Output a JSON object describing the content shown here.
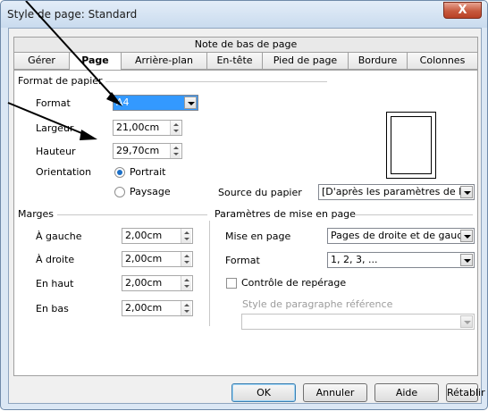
{
  "window": {
    "title": "Style de page: Standard",
    "close_label": "X"
  },
  "tabs": {
    "top_row": "Note de bas de page",
    "items": [
      {
        "label": "Gérer"
      },
      {
        "label": "Page"
      },
      {
        "label": "Arrière-plan"
      },
      {
        "label": "En-tête"
      },
      {
        "label": "Pied de page"
      },
      {
        "label": "Bordure"
      },
      {
        "label": "Colonnes"
      }
    ],
    "active": "Page"
  },
  "paper_format": {
    "section_title": "Format de papier",
    "format_label": "Format",
    "format_value": "A4",
    "width_label": "Largeur",
    "width_value": "21,00cm",
    "height_label": "Hauteur",
    "height_value": "29,70cm",
    "orientation_label": "Orientation",
    "portrait_label": "Portrait",
    "landscape_label": "Paysage",
    "paper_source_label": "Source du papier",
    "paper_source_value": "[D'après les paramètres de l'"
  },
  "margins": {
    "section_title": "Marges",
    "left_label": "À gauche",
    "left_value": "2,00cm",
    "right_label": "À droite",
    "right_value": "2,00cm",
    "top_label": "En haut",
    "top_value": "2,00cm",
    "bottom_label": "En bas",
    "bottom_value": "2,00cm"
  },
  "layout": {
    "section_title": "Paramètres de mise en page",
    "page_layout_label": "Mise en page",
    "page_layout_value": "Pages de droite et de gauc",
    "format_label": "Format",
    "format_value": "1, 2, 3, ...",
    "register_label": "Contrôle de repérage",
    "register_checked": false,
    "ref_style_label": "Style de paragraphe référence",
    "ref_style_value": ""
  },
  "buttons": {
    "ok": "OK",
    "cancel": "Annuler",
    "help": "Aide",
    "reset": "Rétablir"
  },
  "colors": {
    "selection": "#3399ff",
    "radio_dot": "#1b6fc7",
    "frame": "#dbe7f4"
  }
}
